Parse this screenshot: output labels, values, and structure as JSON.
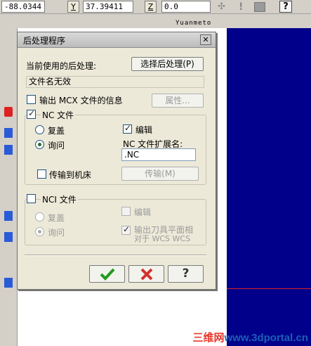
{
  "toolbar": {
    "x_value": "-88.0344",
    "y_label": "Y",
    "y_value": "37.39411",
    "z_label": "Z",
    "z_value": "0.0",
    "help_icon": "question-icon"
  },
  "app": {
    "subtitle": "Yuanmeto"
  },
  "dialog": {
    "title": "后处理程序",
    "current_post_label": "当前使用的后处理:",
    "select_post_button": "选择后处理(P)",
    "current_post_value": "文件名无效",
    "output_mcx_label": "输出 MCX 文件的信息",
    "output_mcx_checked": false,
    "properties_button": "属性...",
    "nc": {
      "label": "NC 文件",
      "checked": true,
      "overwrite_label": "复盖",
      "ask_label": "询问",
      "selected": "ask",
      "edit_label": "编辑",
      "edit_checked": true,
      "ext_label": "NC 文件扩展名:",
      "ext_value": ".NC",
      "send_label": "传输到机床",
      "send_checked": false,
      "send_button": "传输(M)"
    },
    "nci": {
      "label": "NCI 文件",
      "checked": false,
      "overwrite_label": "复盖",
      "ask_label": "询问",
      "selected": "ask",
      "edit_label": "编辑",
      "edit_checked": false,
      "output_planes_label_1": "输出刀具平面相",
      "output_planes_label_2": "对于 WCS WCS",
      "output_planes_checked": true
    },
    "ok_icon": "checkmark-icon",
    "cancel_icon": "x-icon",
    "help_icon": "question-icon"
  },
  "watermark": {
    "prefix": "三维网",
    "domain": "www.3dportal.cn"
  },
  "colors": {
    "viewport": "#00008b",
    "ok_green": "#1f9a1f",
    "cancel_red": "#d2322d"
  }
}
